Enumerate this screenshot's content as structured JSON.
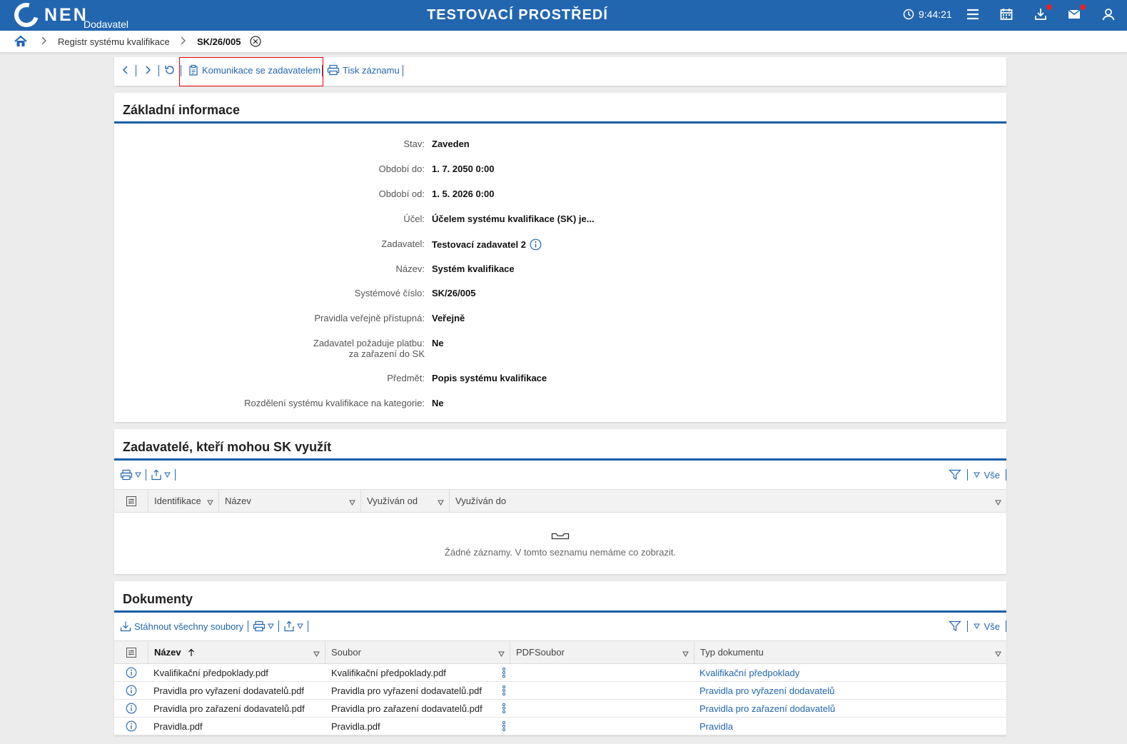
{
  "header": {
    "logo_text": "NEN",
    "logo_sub": "Dodavatel",
    "env_title": "TESTOVACÍ PROSTŘEDÍ",
    "time": "9:44:21"
  },
  "breadcrumb": {
    "items": [
      "Registr systému kvalifikace",
      "SK/26/005"
    ]
  },
  "toolbar": {
    "komunikace": "Komunikace se zadavatelem",
    "tisk": "Tisk záznamu"
  },
  "zakladni": {
    "title": "Základní informace",
    "rows": [
      {
        "label": "Stav:",
        "value": "Zaveden"
      },
      {
        "label": "Období do:",
        "value": "1. 7. 2050 0:00"
      },
      {
        "label": "Období od:",
        "value": "1. 5. 2026 0:00"
      },
      {
        "label": "Účel:",
        "value": "Účelem systému kvalifikace (SK) je..."
      },
      {
        "label": "Zadavatel:",
        "value": "Testovací zadavatel 2"
      },
      {
        "label": "Název:",
        "value": "Systém kvalifikace"
      },
      {
        "label": "Systémové číslo:",
        "value": "SK/26/005"
      },
      {
        "label": "Pravidla veřejně přístupná:",
        "value": "Veřejně"
      },
      {
        "label": "Zadavatel požaduje platbu:",
        "label2": "za zařazení do SK",
        "value": "Ne"
      },
      {
        "label": "Předmět:",
        "value": "Popis systému kvalifikace"
      },
      {
        "label": "Rozdělení systému kvalifikace na kategorie:",
        "value": "Ne"
      }
    ]
  },
  "zadavatele": {
    "title": "Zadavatelé, kteří mohou SK využít",
    "filter_all": "Vše",
    "columns": [
      "Identifikace",
      "Název",
      "Využíván od",
      "Využíván do"
    ],
    "empty": "Žádné záznamy. V tomto seznamu nemáme co zobrazit."
  },
  "dokumenty": {
    "title": "Dokumenty",
    "download_all": "Stáhnout všechny soubory",
    "filter_all": "Vše",
    "columns": [
      "Název",
      "Soubor",
      "PDFSoubor",
      "Typ dokumentu"
    ],
    "rows": [
      {
        "nazev": "Kvalifikační předpoklady.pdf",
        "soubor": "Kvalifikační předpoklady.pdf",
        "typ": "Kvalifikační předpoklady"
      },
      {
        "nazev": "Pravidla pro vyřazení dodavatelů.pdf",
        "soubor": "Pravidla pro vyřazení dodavatelů.pdf",
        "typ": "Pravidla pro vyřazení dodavatelů"
      },
      {
        "nazev": "Pravidla pro zařazení dodavatelů.pdf",
        "soubor": "Pravidla pro zařazení dodavatelů.pdf",
        "typ": "Pravidla pro zařazení dodavatelů"
      },
      {
        "nazev": "Pravidla.pdf",
        "soubor": "Pravidla.pdf",
        "typ": "Pravidla"
      }
    ]
  },
  "icons": {
    "home": "home-icon",
    "clock": "clock-icon",
    "menu": "menu-icon",
    "calendar": "calendar-icon",
    "download": "download-icon",
    "mail": "mail-icon",
    "user": "user-icon",
    "print": "print-icon",
    "export": "export-icon",
    "filter": "filter-icon",
    "info": "info-icon"
  },
  "colors": {
    "brand": "#2266b0",
    "rule": "#1a5ea8",
    "alert_dot": "#e1242b"
  }
}
